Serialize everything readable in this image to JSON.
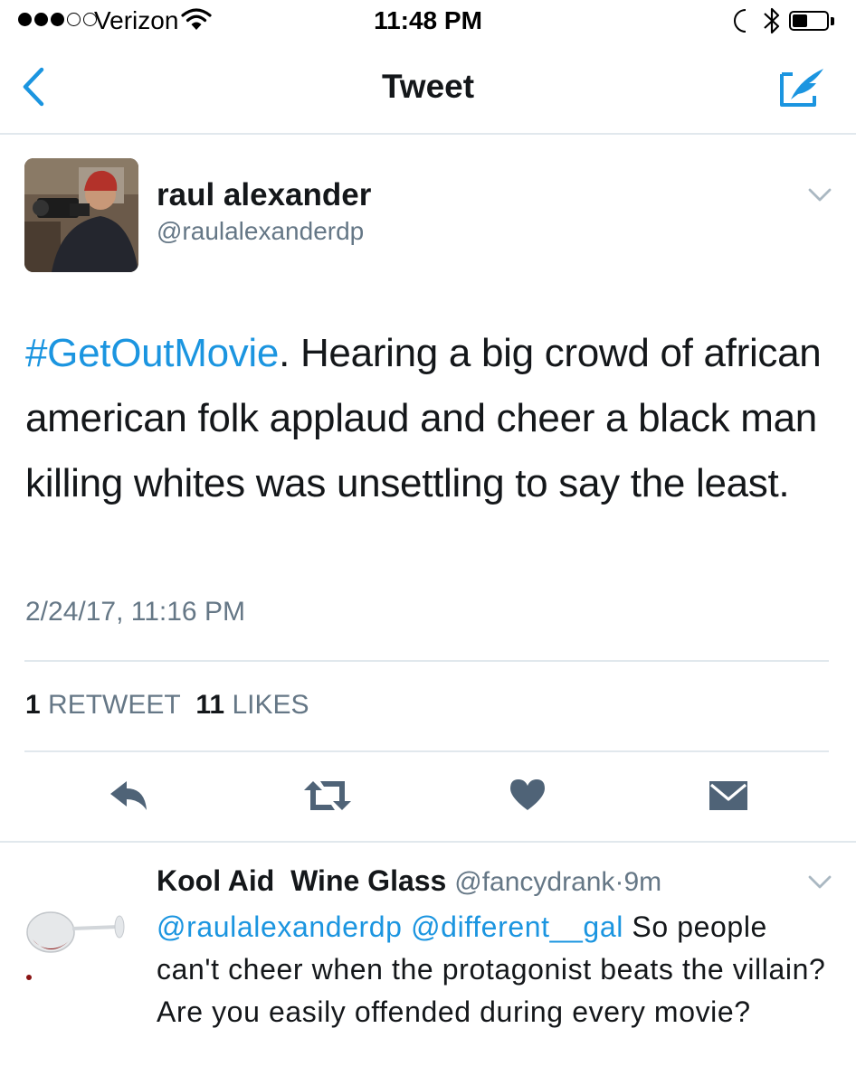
{
  "status_bar": {
    "carrier": "Verizon",
    "time": "11:48 PM",
    "battery_level": 0.45
  },
  "nav": {
    "title": "Tweet"
  },
  "tweet": {
    "display_name": "raul alexander",
    "handle": "@raulalexanderdp",
    "hashtag": "#GetOutMovie",
    "text": ". Hearing a big crowd of african american folk applaud and cheer a black man killing whites was unsettling to say the least.",
    "timestamp": "2/24/17, 11:16 PM",
    "retweet_count": "1",
    "retweet_label": "RETWEET",
    "like_count": "11",
    "like_label": "LIKES"
  },
  "reply": {
    "display_name": "Kool Aid  Wine Glass",
    "handle": "@fancydrank",
    "separator": "·",
    "age": "9m",
    "mention_1": "@raulalexanderdp",
    "mention_2": "@different__gal",
    "text": " So people can't cheer when the protagonist beats the villain? Are you easily offended during every movie?"
  },
  "colors": {
    "link_blue": "#1b95e0",
    "secondary_gray": "#657786",
    "action_gray": "#4f6377",
    "divider": "#e1e8ed"
  },
  "icons": [
    "back-icon",
    "compose-icon",
    "chevron-down-icon",
    "reply-icon",
    "retweet-icon",
    "heart-icon",
    "direct-message-icon",
    "wifi-icon",
    "moon-icon",
    "bluetooth-icon"
  ]
}
